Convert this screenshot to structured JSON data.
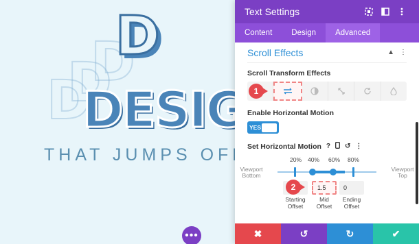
{
  "canvas": {
    "big_letter": "D",
    "design_word": "DESIG",
    "tagline": "THAT JUMPS OFF T",
    "dots_button": "•••"
  },
  "panel": {
    "title": "Text Settings",
    "header_icons": [
      "screenshot-icon",
      "sidebar-icon",
      "more-vertical-icon"
    ],
    "tabs": [
      {
        "label": "Content",
        "active": false
      },
      {
        "label": "Design",
        "active": false
      },
      {
        "label": "Advanced",
        "active": true
      }
    ],
    "section_title": "Scroll Effects",
    "scroll_transform_label": "Scroll Transform Effects",
    "effect_icons": [
      "vertical-motion-icon",
      "horizontal-motion-icon",
      "fading-icon",
      "scaling-icon",
      "rotating-icon",
      "blur-icon"
    ],
    "enable_horizontal_label": "Enable Horizontal Motion",
    "toggle_text": "YES",
    "set_horizontal_label": "Set Horizontal Motion",
    "percentages": [
      "20%",
      "40%",
      "60%",
      "80%"
    ],
    "viewport_bottom": "Viewport\nBottom",
    "viewport_top": "Viewport\nTop",
    "offsets": [
      {
        "label": "Starting\nOffset",
        "value": ""
      },
      {
        "label": "Mid\nOffset",
        "value": "1.5"
      },
      {
        "label": "Ending\nOffset",
        "value": "0"
      }
    ],
    "markers": [
      "1",
      "2"
    ],
    "footer": {
      "cancel": "✖",
      "undo": "↺",
      "redo": "↻",
      "save": "✔"
    }
  },
  "colors": {
    "purple": "#7b3fc4",
    "blue": "#2d8fd6",
    "red": "#e5484d",
    "green": "#29c4a9"
  }
}
